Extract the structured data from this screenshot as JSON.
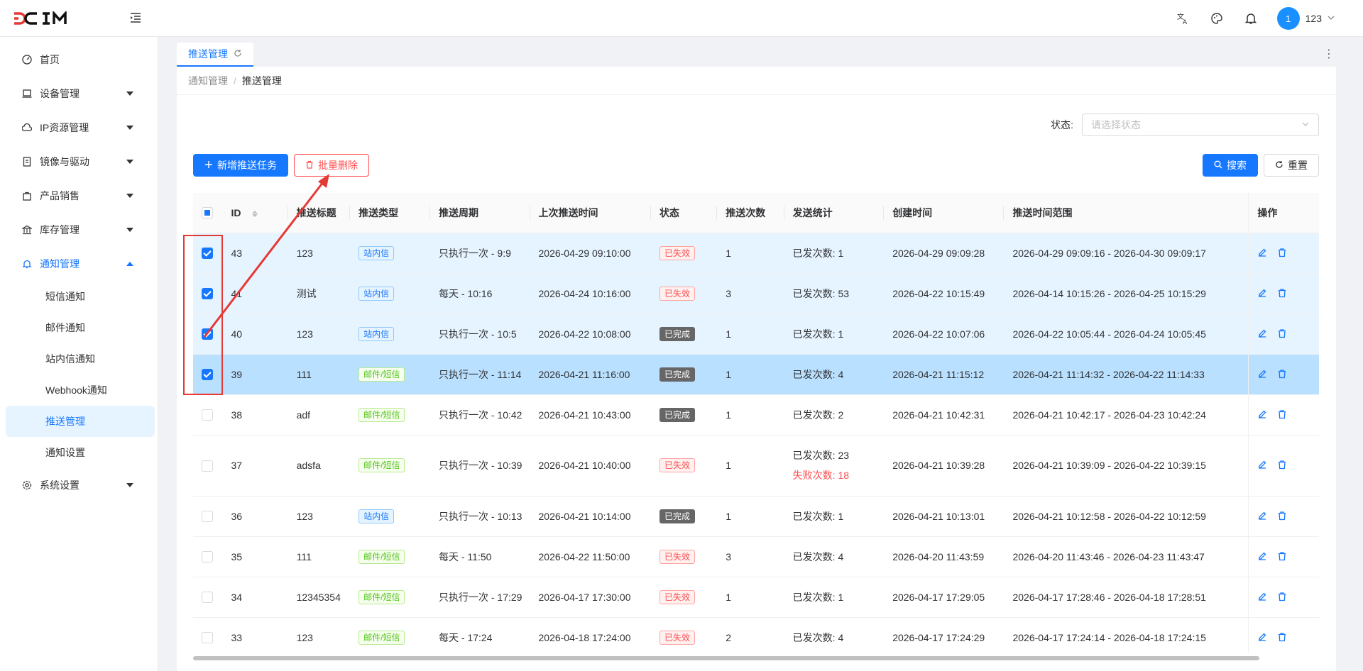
{
  "app": {
    "logo": "DCIM"
  },
  "header": {
    "user": {
      "avatar_text": "1",
      "name": "123"
    }
  },
  "sidebar": {
    "items": [
      {
        "label": "首页",
        "icon": "dashboard-icon"
      },
      {
        "label": "设备管理",
        "icon": "laptop-icon"
      },
      {
        "label": "IP资源管理",
        "icon": "cloud-icon"
      },
      {
        "label": "镜像与驱动",
        "icon": "file-icon"
      },
      {
        "label": "产品销售",
        "icon": "shopping-icon"
      },
      {
        "label": "库存管理",
        "icon": "bank-icon"
      },
      {
        "label": "通知管理",
        "icon": "bell-icon"
      },
      {
        "label": "系统设置",
        "icon": "setting-icon"
      }
    ],
    "notice_sub": [
      "短信通知",
      "邮件通知",
      "站内信通知",
      "Webhook通知",
      "推送管理",
      "通知设置"
    ]
  },
  "tabs": [
    {
      "label": "推送管理"
    }
  ],
  "breadcrumb": {
    "parent": "通知管理",
    "sep": "/",
    "current": "推送管理"
  },
  "filter": {
    "status_label": "状态:",
    "status_placeholder": "请选择状态"
  },
  "actions": {
    "add_label": "新增推送任务",
    "batch_delete_label": "批量删除",
    "search_label": "搜索",
    "reset_label": "重置"
  },
  "table": {
    "columns": [
      "ID",
      "推送标题",
      "推送类型",
      "推送周期",
      "上次推送时间",
      "状态",
      "推送次数",
      "发送统计",
      "创建时间",
      "推送时间范围",
      "操作"
    ],
    "rows": [
      {
        "checked": true,
        "id": "43",
        "title": "123",
        "type": "站内信",
        "type_color": "blue",
        "cycle": "只执行一次 - 9:9",
        "last": "2026-04-29 09:10:00",
        "status": "已失效",
        "status_color": "red",
        "count": "1",
        "stats": "已发次数: 1",
        "fail": "",
        "created": "2026-04-29 09:09:28",
        "range": "2026-04-29 09:09:16 - 2026-04-30 09:09:17"
      },
      {
        "checked": true,
        "id": "41",
        "title": "测试",
        "type": "站内信",
        "type_color": "blue",
        "cycle": "每天 - 10:16",
        "last": "2026-04-24 10:16:00",
        "status": "已失效",
        "status_color": "red",
        "count": "3",
        "stats": "已发次数: 53",
        "fail": "",
        "created": "2026-04-22 10:15:49",
        "range": "2026-04-14 10:15:26 - 2026-04-25 10:15:29"
      },
      {
        "checked": true,
        "id": "40",
        "title": "123",
        "type": "站内信",
        "type_color": "blue",
        "cycle": "只执行一次 - 10:5",
        "last": "2026-04-22 10:08:00",
        "status": "已完成",
        "status_color": "gray",
        "count": "1",
        "stats": "已发次数: 1",
        "fail": "",
        "created": "2026-04-22 10:07:06",
        "range": "2026-04-22 10:05:44 - 2026-04-24 10:05:45"
      },
      {
        "checked": true,
        "id": "39",
        "title": "111",
        "type": "邮件/短信",
        "type_color": "green",
        "cycle": "只执行一次 - 11:14",
        "last": "2026-04-21 11:16:00",
        "status": "已完成",
        "status_color": "gray",
        "count": "1",
        "stats": "已发次数: 4",
        "fail": "",
        "created": "2026-04-21 11:15:12",
        "range": "2026-04-21 11:14:32 - 2026-04-22 11:14:33"
      },
      {
        "checked": false,
        "id": "38",
        "title": "adf",
        "type": "邮件/短信",
        "type_color": "green",
        "cycle": "只执行一次 - 10:42",
        "last": "2026-04-21 10:43:00",
        "status": "已完成",
        "status_color": "gray",
        "count": "1",
        "stats": "已发次数: 2",
        "fail": "",
        "created": "2026-04-21 10:42:31",
        "range": "2026-04-21 10:42:17 - 2026-04-23 10:42:24"
      },
      {
        "checked": false,
        "id": "37",
        "title": "adsfa",
        "type": "邮件/短信",
        "type_color": "green",
        "cycle": "只执行一次 - 10:39",
        "last": "2026-04-21 10:40:00",
        "status": "已失效",
        "status_color": "red",
        "count": "1",
        "stats": "已发次数: 23",
        "fail": "失败次数: 18",
        "created": "2026-04-21 10:39:28",
        "range": "2026-04-21 10:39:09 - 2026-04-22 10:39:15"
      },
      {
        "checked": false,
        "id": "36",
        "title": "123",
        "type": "站内信",
        "type_color": "blue",
        "cycle": "只执行一次 - 10:13",
        "last": "2026-04-21 10:14:00",
        "status": "已完成",
        "status_color": "gray",
        "count": "1",
        "stats": "已发次数: 1",
        "fail": "",
        "created": "2026-04-21 10:13:01",
        "range": "2026-04-21 10:12:58 - 2026-04-22 10:12:59"
      },
      {
        "checked": false,
        "id": "35",
        "title": "111",
        "type": "邮件/短信",
        "type_color": "green",
        "cycle": "每天 - 11:50",
        "last": "2026-04-22 11:50:00",
        "status": "已失效",
        "status_color": "red",
        "count": "3",
        "stats": "已发次数: 4",
        "fail": "",
        "created": "2026-04-20 11:43:59",
        "range": "2026-04-20 11:43:46 - 2026-04-23 11:43:47"
      },
      {
        "checked": false,
        "id": "34",
        "title": "12345354",
        "type": "邮件/短信",
        "type_color": "green",
        "cycle": "只执行一次 - 17:29",
        "last": "2026-04-17 17:30:00",
        "status": "已失效",
        "status_color": "red",
        "count": "1",
        "stats": "已发次数: 1",
        "fail": "",
        "created": "2026-04-17 17:29:05",
        "range": "2026-04-17 17:28:46 - 2026-04-18 17:28:51"
      },
      {
        "checked": false,
        "id": "33",
        "title": "123",
        "type": "邮件/短信",
        "type_color": "green",
        "cycle": "每天 - 17:24",
        "last": "2026-04-18 17:24:00",
        "status": "已失效",
        "status_color": "red",
        "count": "2",
        "stats": "已发次数: 4",
        "fail": "",
        "created": "2026-04-17 17:24:29",
        "range": "2026-04-17 17:24:14 - 2026-04-18 17:24:15"
      }
    ]
  },
  "colors": {
    "primary": "#1677ff",
    "danger": "#ff4d4f",
    "success": "#52c41a",
    "annotation": "#e53935"
  }
}
